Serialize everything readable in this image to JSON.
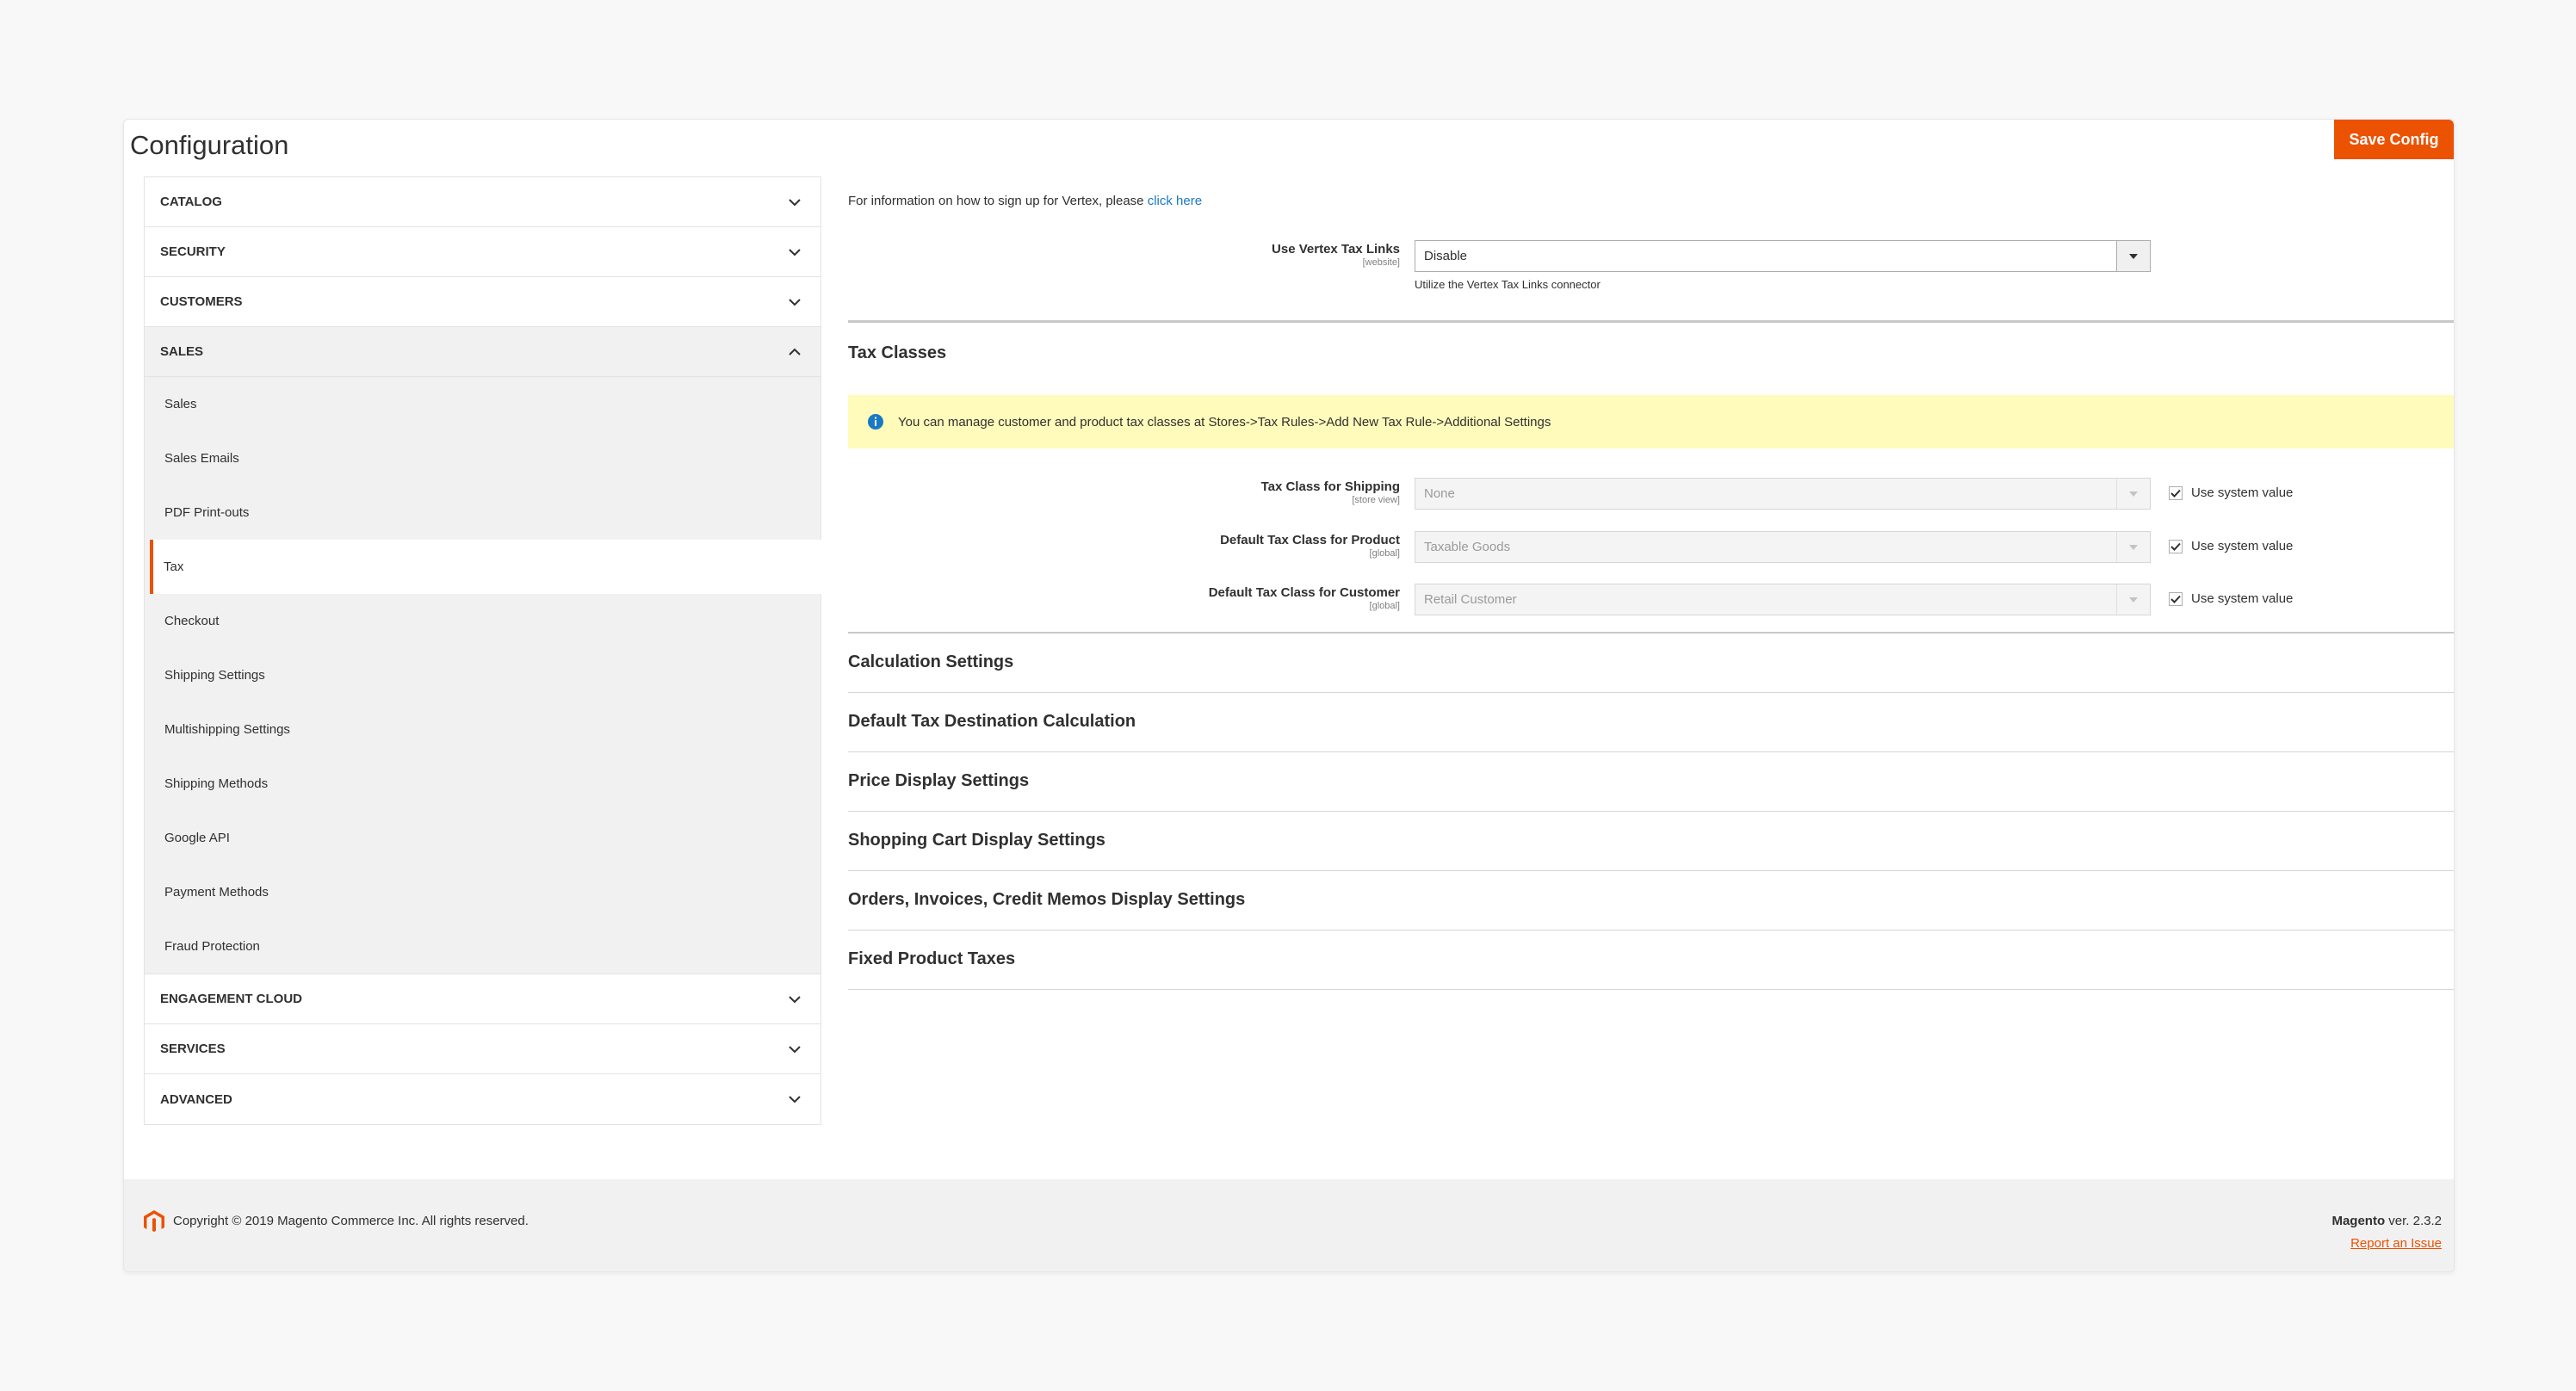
{
  "page": {
    "title": "Configuration"
  },
  "actions": {
    "save_label": "Save Config"
  },
  "sidebar": {
    "groups_top": [
      {
        "label": "CATALOG"
      },
      {
        "label": "SECURITY"
      },
      {
        "label": "CUSTOMERS"
      }
    ],
    "open_group": {
      "label": "SALES",
      "items": [
        {
          "label": "Sales"
        },
        {
          "label": "Sales Emails"
        },
        {
          "label": "PDF Print-outs"
        },
        {
          "label": "Tax"
        },
        {
          "label": "Checkout"
        },
        {
          "label": "Shipping Settings"
        },
        {
          "label": "Multishipping Settings"
        },
        {
          "label": "Shipping Methods"
        },
        {
          "label": "Google API"
        },
        {
          "label": "Payment Methods"
        },
        {
          "label": "Fraud Protection"
        }
      ],
      "active_item": "Tax"
    },
    "groups_bottom": [
      {
        "label": "ENGAGEMENT CLOUD"
      },
      {
        "label": "SERVICES"
      },
      {
        "label": "ADVANCED"
      }
    ]
  },
  "vertex": {
    "info_text": "For information on how to sign up for Vertex, please ",
    "info_link": "click here",
    "field_label": "Use Vertex Tax Links",
    "field_scope": "[website]",
    "field_value": "Disable",
    "field_note": "Utilize the Vertex Tax Links connector"
  },
  "tax_classes": {
    "title": "Tax Classes",
    "notice": "You can manage customer and product tax classes at Stores->Tax Rules->Add New Tax Rule->Additional Settings",
    "fields": [
      {
        "label": "Tax Class for Shipping",
        "scope": "[store view]",
        "value": "None",
        "checkbox": "Use system value"
      },
      {
        "label": "Default Tax Class for Product",
        "scope": "[global]",
        "value": "Taxable Goods",
        "checkbox": "Use system value"
      },
      {
        "label": "Default Tax Class for Customer",
        "scope": "[global]",
        "value": "Retail Customer",
        "checkbox": "Use system value"
      }
    ]
  },
  "sections": [
    {
      "title": "Calculation Settings"
    },
    {
      "title": "Default Tax Destination Calculation"
    },
    {
      "title": "Price Display Settings"
    },
    {
      "title": "Shopping Cart Display Settings"
    },
    {
      "title": "Orders, Invoices, Credit Memos Display Settings"
    },
    {
      "title": "Fixed Product Taxes"
    }
  ],
  "footer": {
    "copyright": "Copyright © 2019 Magento Commerce Inc. All rights reserved.",
    "brand": "Magento",
    "version": " ver. 2.3.2",
    "report_link": "Report an Issue"
  },
  "colors": {
    "accent": "#eb5202",
    "link": "#1979c3",
    "notice_bg": "#fffbbb",
    "info_icon": "#1979c3"
  }
}
